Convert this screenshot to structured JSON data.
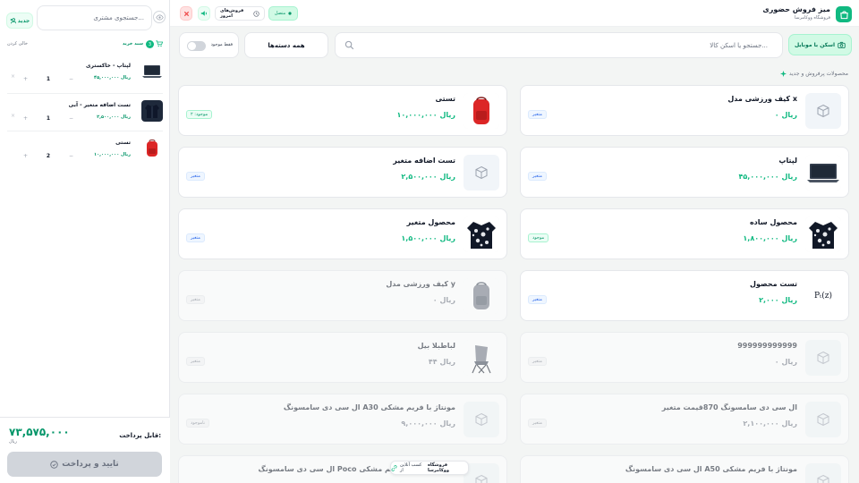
{
  "cart": {
    "new_label": "جدید",
    "customer_search_placeholder": "جستجوی مشتری...",
    "clear_label": "خالی کردن",
    "title": "سبد خرید",
    "count": "3",
    "items": [
      {
        "name": "لپتاپ - خاکستری",
        "price": "۴۵,۰۰۰,۰۰۰ ریال",
        "qty": "1",
        "minus": "−",
        "plus": "+",
        "remove": "×"
      },
      {
        "name": "تست اضافه متغیر - آبی",
        "price": "۲,۵۰۰,۰۰۰ ریال",
        "qty": "1",
        "minus": "−",
        "plus": "+",
        "remove": "×"
      },
      {
        "name": "تستی",
        "price": "۱۰,۰۰۰,۰۰۰ ریال",
        "qty": "2",
        "minus": "−",
        "plus": "+",
        "remove": "×"
      }
    ],
    "payable_label": "قابل پرداخت:",
    "total": "۷۳,۵۷۵,۰۰۰",
    "total_unit": "ریال",
    "pay_label": "تایید و پرداخت"
  },
  "topbar": {
    "title": "میز فروش حضوری",
    "subtitle": "فروشگاه ووکامرسا",
    "active_label": "متصل",
    "today_sales_label": "فروش‌های امروز"
  },
  "search": {
    "scan_label": "اسکن با موبایل",
    "placeholder": "جستجو یا اسکن کالا...",
    "category": "همه دسته‌ها",
    "in_stock_label": "فقط موجود"
  },
  "section_title": "محصولات پرفروش و جدید",
  "products": [
    {
      "title": "کیف ورزشی مدل x",
      "price": "۰ ریال",
      "badge": "متغیر",
      "badge_type": "var",
      "image": "box",
      "dim": false
    },
    {
      "title": "تستی",
      "price": "۱۰,۰۰۰,۰۰۰ ریال",
      "badge": "موجود: ۲",
      "badge_type": "stock",
      "image": "bag-red",
      "dim": false
    },
    {
      "title": "لپتاپ",
      "price": "۴۵,۰۰۰,۰۰۰ ریال",
      "badge": "متغیر",
      "badge_type": "var",
      "image": "laptop",
      "dim": false
    },
    {
      "title": "تست اضافه متغیر",
      "price": "۲,۵۰۰,۰۰۰ ریال",
      "badge": "متغیر",
      "badge_type": "var",
      "image": "box",
      "dim": false
    },
    {
      "title": "محصول ساده",
      "price": "۱,۸۰۰,۰۰۰ ریال",
      "badge": "موجود",
      "badge_type": "stock",
      "image": "shirt",
      "dim": false
    },
    {
      "title": "محصول متغیر",
      "price": "۱,۵۰۰,۰۰۰ ریال",
      "badge": "متغیر",
      "badge_type": "var",
      "image": "shirt",
      "dim": false
    },
    {
      "title": "تست محصول",
      "price": "۲,۰۰۰ ریال",
      "badge": "متغیر",
      "badge_type": "var",
      "image": "formula",
      "image_text": "Pₜ(z)",
      "dim": false
    },
    {
      "title": "کیف ورزشی مدل y",
      "price": "۰ ریال",
      "badge": "متغیر",
      "badge_type": "var",
      "image": "bag-gray",
      "dim": true
    },
    {
      "title": "999999999999",
      "price": "۰ ریال",
      "badge": "متغیر",
      "badge_type": "var",
      "image": "box",
      "dim": true
    },
    {
      "title": "لباطبلا بیل",
      "price": "۴۴ ریال",
      "badge": "متغیر",
      "badge_type": "var",
      "image": "chair",
      "dim": true
    },
    {
      "title": "ال سی دی سامسونگ 870قیمت متغیر",
      "price": "۲,۱۰۰,۰۰۰ ریال",
      "badge": "متغیر",
      "badge_type": "var",
      "image": "box",
      "dim": true
    },
    {
      "title": "ال سی دی سامسونگ A30 مونتاژ با فریم مشکی",
      "price": "۹,۰۰۰,۰۰۰ ریال",
      "badge": "ناموجود",
      "badge_type": "gray",
      "image": "box",
      "dim": true
    },
    {
      "title": "ال سی دی سامسونگ A50 مونتاژ با فریم مشکی",
      "price": "",
      "badge": "",
      "badge_type": "var",
      "image": "box",
      "dim": true
    },
    {
      "title": "ال سی دی سامسونگ Poco اورجینال بدون فریم مشکی",
      "price": "",
      "badge": "",
      "badge_type": "var",
      "image": "box",
      "dim": true
    }
  ],
  "store_tag": {
    "label": "فروشگاه ووکامرسا",
    "prefix": "کسب آنلاین از"
  },
  "colors": {
    "accent": "#10b981",
    "accent_dark": "#059669",
    "variable_badge": "#2563eb"
  }
}
